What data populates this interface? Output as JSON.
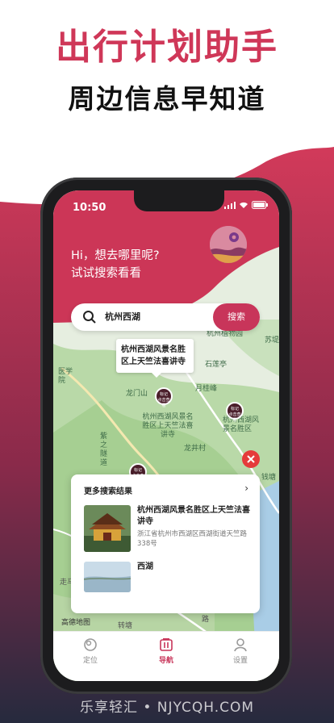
{
  "promo": {
    "headline": "出行计划助手",
    "subheadline": "周边信息早知道"
  },
  "status_bar": {
    "time": "10:50"
  },
  "header": {
    "greeting_line1": "Hi，想去哪里呢?",
    "greeting_line2": "试试搜索看看"
  },
  "search": {
    "value": "杭州西湖",
    "button_label": "搜索"
  },
  "map": {
    "callout": "杭州西湖风景名胜区上天竺法喜讲寺",
    "labels": [
      "杭州植物园",
      "苏堤",
      "石莲亭",
      "月桂峰",
      "龙门山",
      "杭州西湖风景名胜区上天竺法喜讲寺",
      "龙井村",
      "医学院",
      "紫之隧道",
      "杭州西湖风景名胜区",
      "钱塘",
      "走马",
      "转塘",
      "路"
    ],
    "pin_label_top": "标记",
    "pin_label_bottom": "点击查看",
    "provider": "高德地图"
  },
  "results": {
    "title": "更多搜索结果",
    "items": [
      {
        "name": "杭州西湖风景名胜区上天竺法喜讲寺",
        "address": "浙江省杭州市西湖区西湖街道天竺路338号"
      },
      {
        "name": "西湖",
        "address": ""
      }
    ]
  },
  "tabs": [
    {
      "label": "定位"
    },
    {
      "label": "导航"
    },
    {
      "label": "设置"
    }
  ],
  "watermark": "乐享轻汇 • NJYCQH.COM",
  "colors": {
    "accent": "#c8355a",
    "headline": "#cf3758",
    "close": "#e53b3b"
  }
}
